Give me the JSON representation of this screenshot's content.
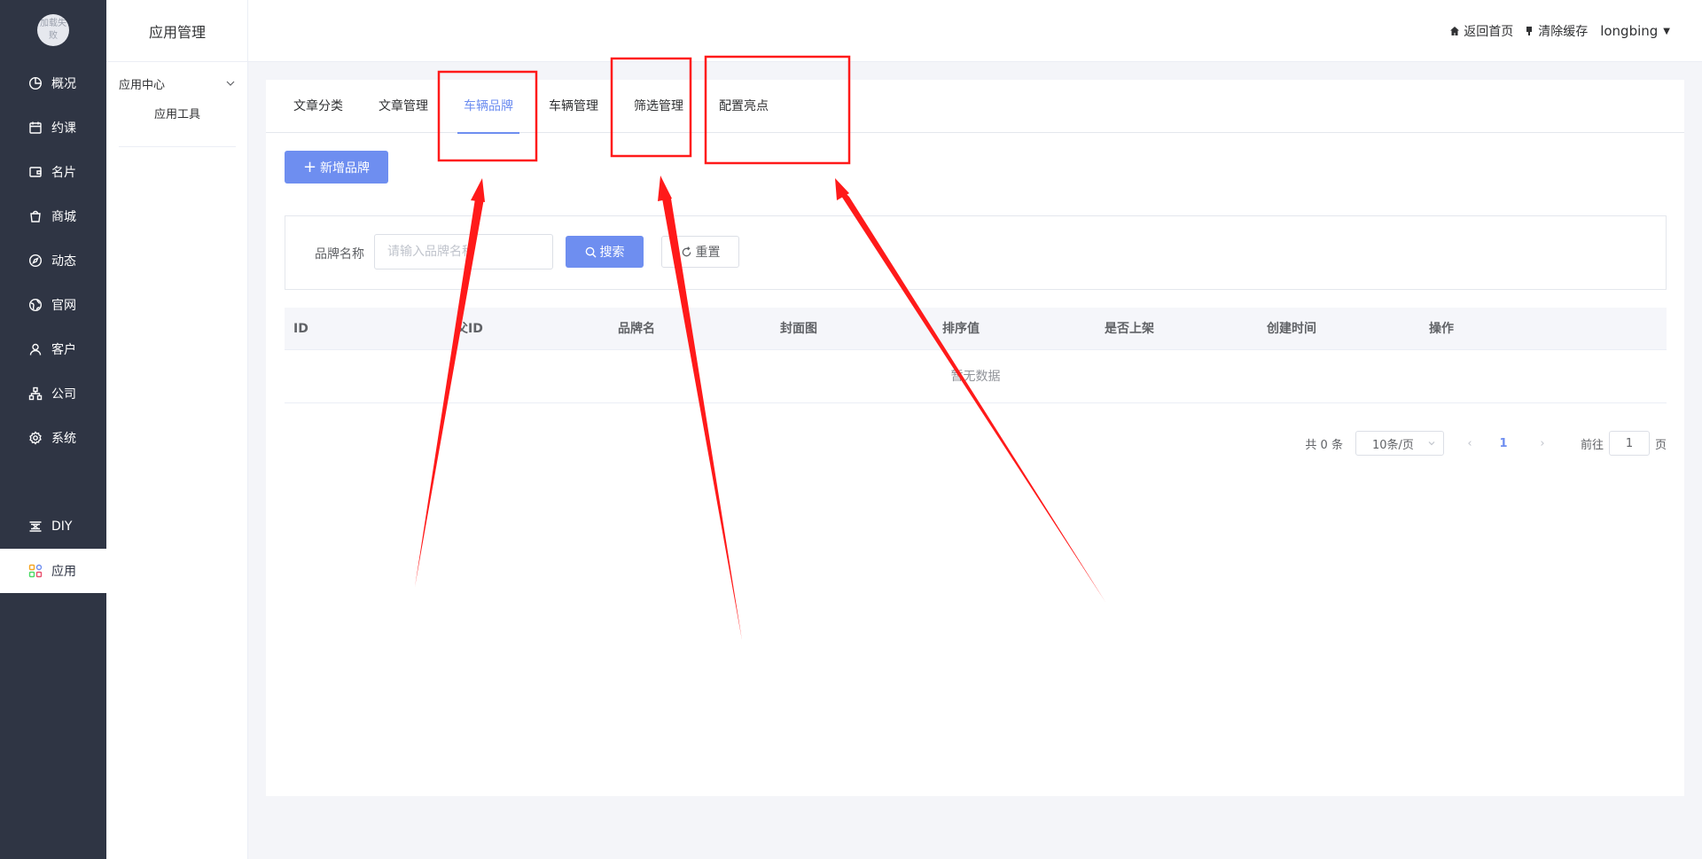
{
  "logo_text": "加载失败",
  "left_nav": {
    "items": [
      {
        "label": "概况",
        "icon": "chart-pie-icon"
      },
      {
        "label": "约课",
        "icon": "calendar-icon"
      },
      {
        "label": "名片",
        "icon": "wallet-icon"
      },
      {
        "label": "商城",
        "icon": "shopping-bag-icon"
      },
      {
        "label": "动态",
        "icon": "compass-icon"
      },
      {
        "label": "官网",
        "icon": "globe-icon"
      },
      {
        "label": "客户",
        "icon": "user-icon"
      },
      {
        "label": "公司",
        "icon": "org-chart-icon"
      },
      {
        "label": "系统",
        "icon": "gear-icon"
      }
    ],
    "diy_label": "DIY",
    "app_label": "应用"
  },
  "sub_nav": {
    "title": "应用管理",
    "group_label": "应用中心",
    "item_label": "应用工具"
  },
  "header": {
    "home_label": "返回首页",
    "clear_cache_label": "清除缓存",
    "username": "longbing"
  },
  "tabs": [
    {
      "label": "文章分类",
      "active": false
    },
    {
      "label": "文章管理",
      "active": false
    },
    {
      "label": "车辆品牌",
      "active": true
    },
    {
      "label": "车辆管理",
      "active": false
    },
    {
      "label": "筛选管理",
      "active": false
    },
    {
      "label": "配置亮点",
      "active": false
    }
  ],
  "toolbar": {
    "add_label": "新增品牌"
  },
  "search": {
    "label": "品牌名称",
    "placeholder": "请输入品牌名称",
    "search_label": "搜索",
    "reset_label": "重置"
  },
  "table": {
    "columns": [
      "ID",
      "父ID",
      "品牌名",
      "封面图",
      "排序值",
      "是否上架",
      "创建时间",
      "操作"
    ],
    "empty_text": "暂无数据"
  },
  "pagination": {
    "total_text": "共 0 条",
    "page_size": "10条/页",
    "current_page": "1",
    "goto_label": "前往",
    "goto_value": "1",
    "goto_suffix": "页"
  },
  "colors": {
    "primary": "#6e8ef0",
    "sidebar": "#2f3544",
    "annotation": "#ff1a1a"
  }
}
